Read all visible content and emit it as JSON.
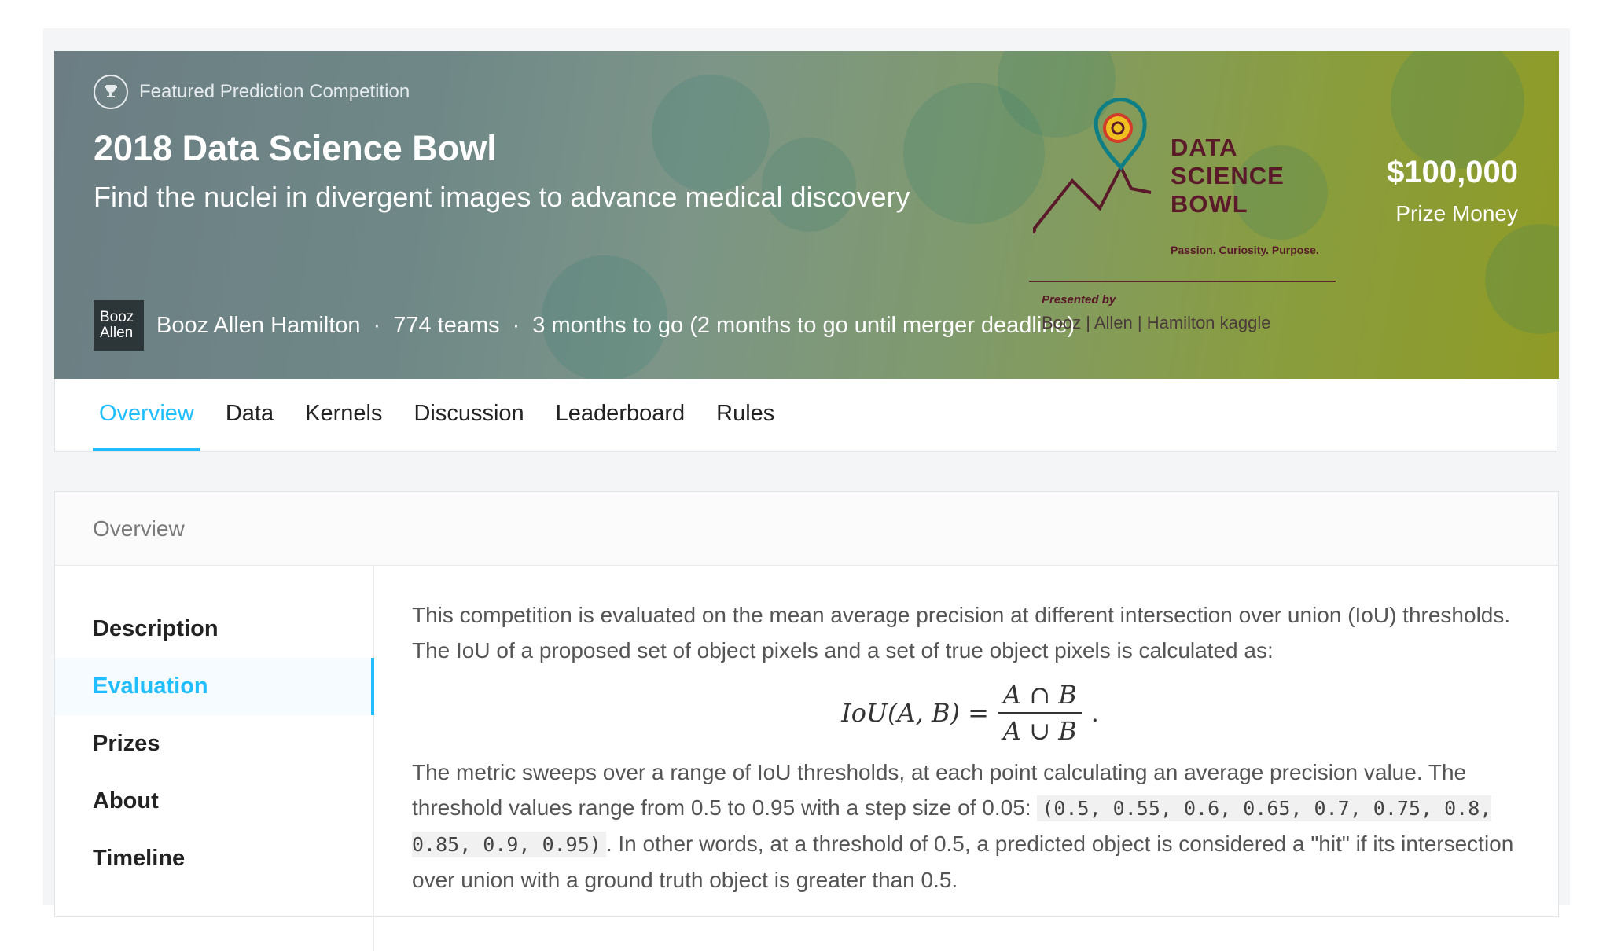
{
  "hero": {
    "badge": "Featured Prediction Competition",
    "title": "2018 Data Science Bowl",
    "subtitle": "Find the nuclei in divergent images to advance medical discovery",
    "org_logo_line1": "Booz",
    "org_logo_line2": "Allen",
    "host": "Booz Allen Hamilton",
    "teams": "774 teams",
    "deadline": "3 months to go (2 months to go until merger deadline)",
    "prize_amount": "$100,000",
    "prize_label": "Prize Money",
    "dsb_logo": {
      "line1": "DATA",
      "line2": "SCIENCE",
      "line3": "BOWL",
      "tagline": "Passion. Curiosity. Purpose.",
      "presented_by": "Presented by",
      "sponsors": "Booz | Allen | Hamilton  kaggle"
    }
  },
  "tabs": [
    "Overview",
    "Data",
    "Kernels",
    "Discussion",
    "Leaderboard",
    "Rules"
  ],
  "active_tab": "Overview",
  "panel": {
    "heading": "Overview",
    "nav": [
      "Description",
      "Evaluation",
      "Prizes",
      "About",
      "Timeline"
    ],
    "active_nav": "Evaluation",
    "para1": "This competition is evaluated on the mean average precision at different intersection over union (IoU) thresholds. The IoU of a proposed set of object pixels and a set of true object pixels is calculated as:",
    "formula_lhs": "IoU(A, B) =",
    "formula_num": "A ∩ B",
    "formula_den": "A ∪ B",
    "para2_a": "The metric sweeps over a range of IoU thresholds, at each point calculating an average precision value. The threshold values range from 0.5 to 0.95 with a step size of 0.05: ",
    "para2_code": "(0.5, 0.55, 0.6, 0.65, 0.7, 0.75, 0.8, 0.85, 0.9, 0.95)",
    "para2_b": ". In other words, at a threshold of 0.5, a predicted object is considered a \"hit\" if its intersection over union with a ground truth object is greater than 0.5."
  },
  "colors": {
    "accent": "#20beff",
    "dsb_maroon": "#5a1a2a"
  }
}
